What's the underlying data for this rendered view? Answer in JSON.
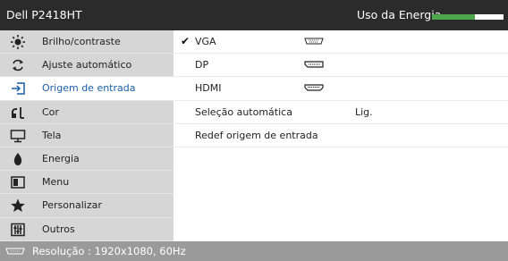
{
  "header": {
    "model": "Dell P2418HT",
    "energy_label": "Uso da Energia",
    "energy_level": 0.6,
    "energy_color": "#4ca64c"
  },
  "sidebar": {
    "items": [
      {
        "label": "Brilho/contraste",
        "icon": "brightness-icon"
      },
      {
        "label": "Ajuste automático",
        "icon": "auto-adjust-icon"
      },
      {
        "label": "Origem de entrada",
        "icon": "input-source-icon",
        "active": true
      },
      {
        "label": "Cor",
        "icon": "color-icon"
      },
      {
        "label": "Tela",
        "icon": "display-icon"
      },
      {
        "label": "Energia",
        "icon": "power-icon"
      },
      {
        "label": "Menu",
        "icon": "menu-icon"
      },
      {
        "label": "Personalizar",
        "icon": "star-icon"
      },
      {
        "label": "Outros",
        "icon": "others-icon"
      }
    ]
  },
  "content": {
    "rows": [
      {
        "label": "VGA",
        "checked": true,
        "icon": "vga-connector-icon"
      },
      {
        "label": "DP",
        "checked": false,
        "icon": "dp-connector-icon"
      },
      {
        "label": "HDMI",
        "checked": false,
        "icon": "hdmi-connector-icon"
      },
      {
        "label": "Seleção automática",
        "value": "Lig."
      },
      {
        "label": "Redef origem de entrada"
      }
    ]
  },
  "footer": {
    "icon": "vga-connector-icon",
    "resolution": "Resolução : 1920x1080, 60Hz"
  },
  "colors": {
    "active_label": "#1a5fa8",
    "sidebar_bg": "#d6d6d6",
    "header_bg": "#2b2b2b",
    "footer_bg": "#9a9a9a"
  }
}
